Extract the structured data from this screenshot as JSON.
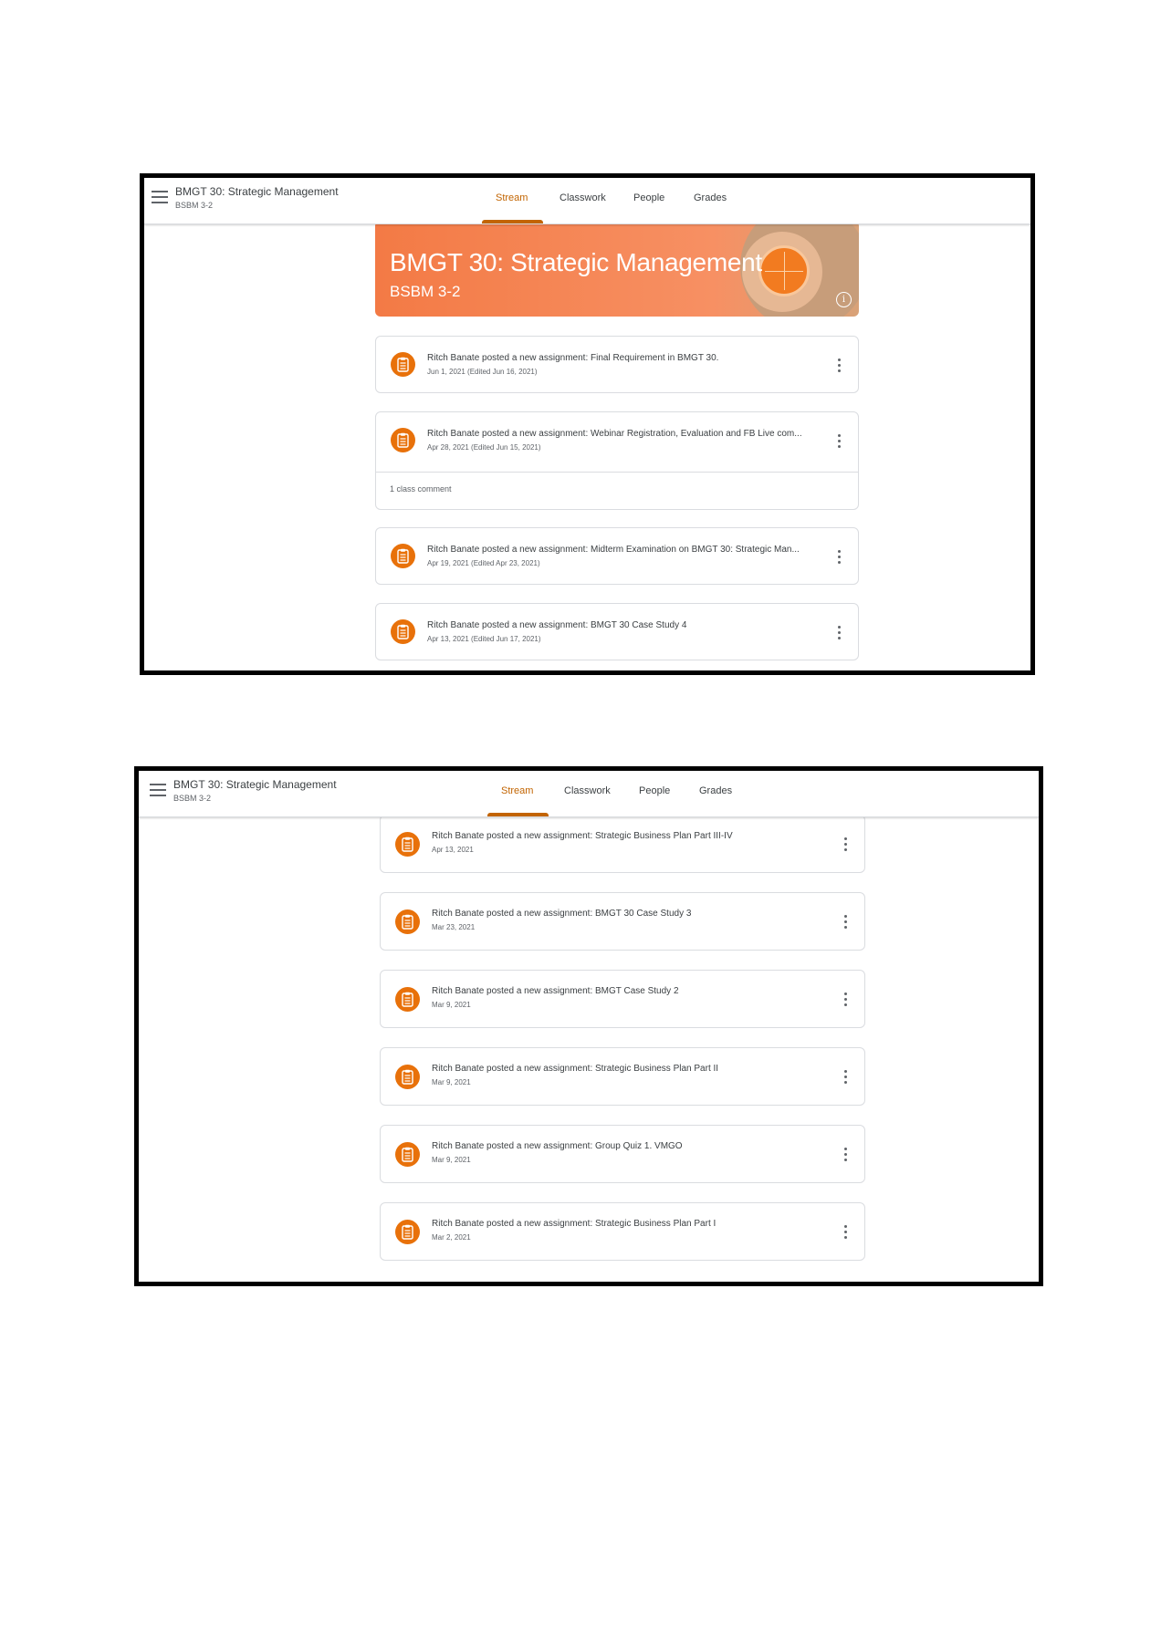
{
  "header": {
    "course_title": "BMGT 30: Strategic Management",
    "course_section": "BSBM 3-2",
    "tabs": [
      "Stream",
      "Classwork",
      "People",
      "Grades"
    ],
    "active_tab": "Stream"
  },
  "banner": {
    "title": "BMGT 30: Strategic Management",
    "section": "BSBM 3-2"
  },
  "colors": {
    "accent": "#c26401",
    "avatar": "#e8710a",
    "banner": "#f37a45"
  },
  "icons": {
    "menu": "hamburger-menu-icon",
    "assignment": "assignment-icon",
    "more": "more-vert-icon",
    "info": "info-icon"
  },
  "screen1_posts": [
    {
      "text": "Ritch Banate posted a new assignment: Final Requirement in BMGT 30.",
      "date": "Jun 1, 2021 (Edited Jun 16, 2021)"
    },
    {
      "text": "Ritch Banate posted a new assignment: Webinar Registration, Evaluation and FB Live com...",
      "date": "Apr 28, 2021 (Edited Jun 15, 2021)",
      "comments": "1 class comment"
    },
    {
      "text": "Ritch Banate posted a new assignment: Midterm Examination on BMGT 30: Strategic Man...",
      "date": "Apr 19, 2021 (Edited Apr 23, 2021)"
    },
    {
      "text": "Ritch Banate posted a new assignment: BMGT 30 Case Study 4",
      "date": "Apr 13, 2021 (Edited Jun 17, 2021)"
    }
  ],
  "screen2_posts": [
    {
      "text": "Ritch Banate posted a new assignment: Strategic Business Plan Part III-IV",
      "date": "Apr 13, 2021"
    },
    {
      "text": "Ritch Banate posted a new assignment: BMGT 30 Case Study 3",
      "date": "Mar 23, 2021"
    },
    {
      "text": "Ritch Banate posted a new assignment: BMGT Case Study 2",
      "date": "Mar 9, 2021"
    },
    {
      "text": "Ritch Banate posted a new assignment: Strategic Business Plan Part II",
      "date": "Mar 9, 2021"
    },
    {
      "text": "Ritch Banate posted a new assignment: Group Quiz 1. VMGO",
      "date": "Mar 9, 2021"
    },
    {
      "text": "Ritch Banate posted a new assignment: Strategic Business Plan Part I",
      "date": "Mar 2, 2021"
    }
  ]
}
